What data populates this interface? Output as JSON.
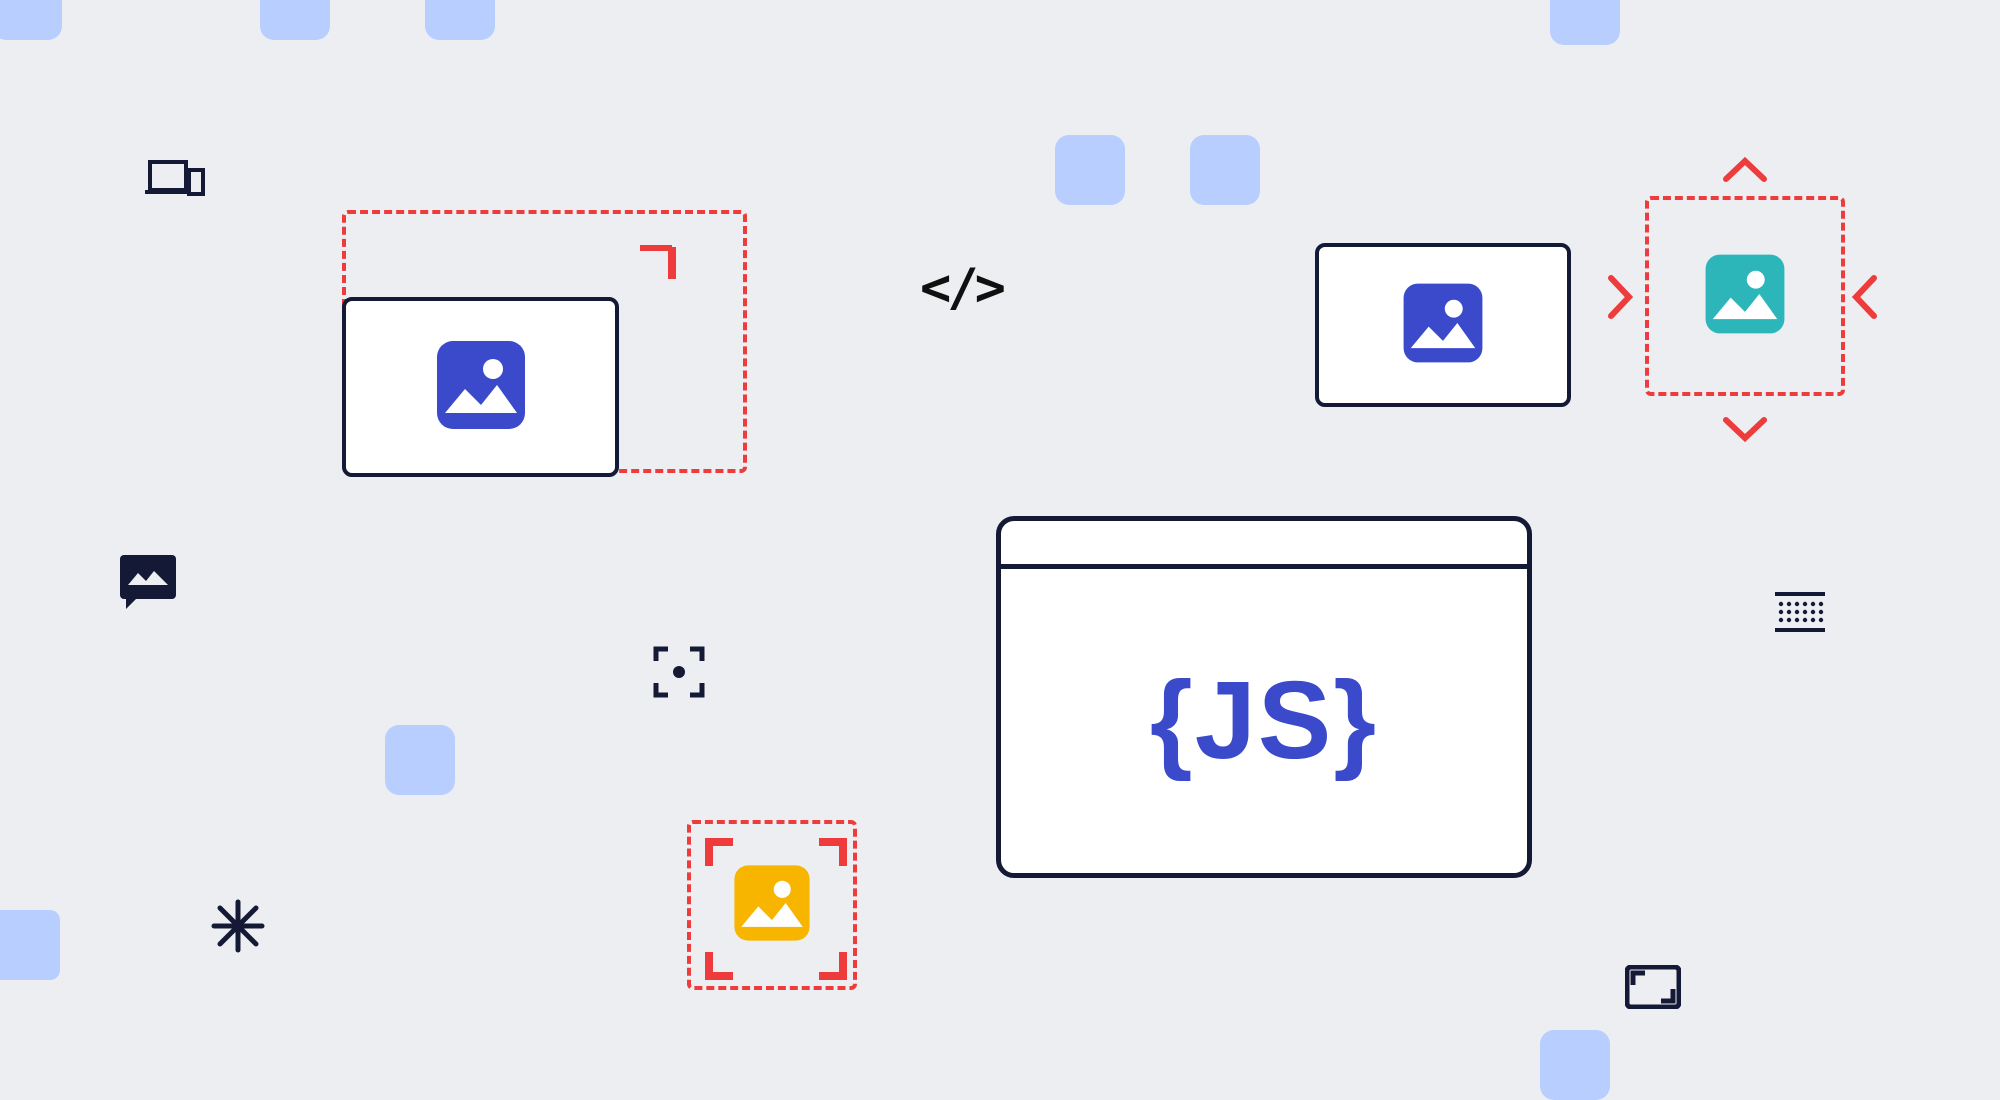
{
  "colors": {
    "background": "#edeef2",
    "accent_blue": "#3b4acb",
    "dark": "#141a35",
    "soft_blue": "#b8ceff",
    "dashed_red": "#ee3b3b",
    "teal": "#2cb6ba",
    "yellow": "#f7b500"
  },
  "icons": {
    "devices": "devices-icon",
    "image_blue": "image-placeholder-blue",
    "image_teal": "image-placeholder-teal",
    "image_yellow": "image-placeholder-yellow",
    "code": "code-angle-brackets",
    "chat_image": "chat-image-bubble",
    "focus_center": "center-focus",
    "asterisk": "asterisk",
    "aspect_ratio": "aspect-ratio",
    "linear_blur": "gradient-dots",
    "chevron_up": "chevron-up",
    "chevron_down": "chevron-down",
    "chevron_left": "chevron-left",
    "chevron_right": "chevron-right",
    "corner": "corner-marker"
  },
  "js_window": {
    "label": "JS",
    "braces_left": "{",
    "braces_right": "}"
  },
  "squares_count": 9
}
